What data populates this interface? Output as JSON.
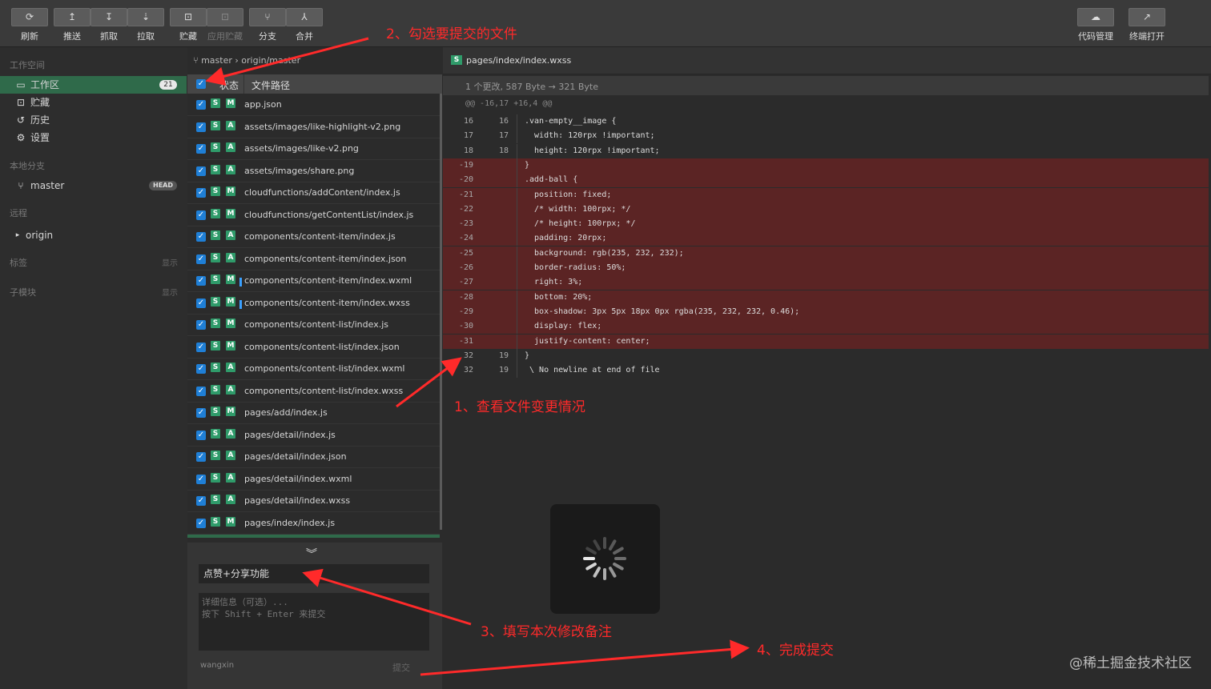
{
  "toolbar": {
    "left": [
      {
        "name": "refresh-button",
        "label": "刷新",
        "icon": "refresh-icon",
        "glyph": "⟳",
        "disabled": false
      },
      {
        "name": "push-button",
        "label": "推送",
        "icon": "push-icon",
        "glyph": "↥",
        "disabled": false
      },
      {
        "name": "fetch-button",
        "label": "抓取",
        "icon": "fetch-icon",
        "glyph": "↧",
        "disabled": false
      },
      {
        "name": "pull-button",
        "label": "拉取",
        "icon": "pull-icon",
        "glyph": "⇣",
        "disabled": false
      },
      {
        "name": "stash-button",
        "label": "贮藏",
        "icon": "stash-icon",
        "glyph": "⊡",
        "disabled": false
      },
      {
        "name": "apply-stash-button",
        "label": "应用贮藏",
        "icon": "apply-stash-icon",
        "glyph": "⊡",
        "disabled": true
      },
      {
        "name": "branch-button",
        "label": "分支",
        "icon": "branch-icon",
        "glyph": "⑂",
        "disabled": false
      },
      {
        "name": "merge-button",
        "label": "合并",
        "icon": "merge-icon",
        "glyph": "⅄",
        "disabled": false
      }
    ],
    "right": [
      {
        "name": "code-management-button",
        "label": "代码管理",
        "icon": "cloud-code-icon",
        "glyph": "☁"
      },
      {
        "name": "terminal-open-button",
        "label": "终端打开",
        "icon": "external-link-icon",
        "glyph": "↗"
      }
    ]
  },
  "sidebar": {
    "workspace_title": "工作空间",
    "items": [
      {
        "name": "sidebar-item-workspace",
        "label": "工作区",
        "icon": "folder-icon",
        "glyph": "▭",
        "badge": "21"
      },
      {
        "name": "sidebar-item-stash",
        "label": "贮藏",
        "icon": "stash-icon",
        "glyph": "⊡"
      },
      {
        "name": "sidebar-item-history",
        "label": "历史",
        "icon": "history-icon",
        "glyph": "↺"
      },
      {
        "name": "sidebar-item-settings",
        "label": "设置",
        "icon": "gear-icon",
        "glyph": "⚙"
      }
    ],
    "local_branches_title": "本地分支",
    "branch": {
      "label": "master",
      "badge": "HEAD",
      "glyph": "⑂"
    },
    "remote_title": "远程",
    "remote": {
      "label": "origin",
      "glyph": "▸"
    },
    "tags_title": "标签",
    "tags_action": "显示",
    "submodules_title": "子模块",
    "submodules_action": "显示"
  },
  "filelist": {
    "breadcrumb": "⑂ master › origin/master",
    "header_state": "状态",
    "header_path": "文件路径",
    "files": [
      {
        "s": "S",
        "m": "M",
        "path": "app.json",
        "marker": false
      },
      {
        "s": "S",
        "m": "A",
        "path": "assets/images/like-highlight-v2.png",
        "marker": false
      },
      {
        "s": "S",
        "m": "A",
        "path": "assets/images/like-v2.png",
        "marker": false
      },
      {
        "s": "S",
        "m": "A",
        "path": "assets/images/share.png",
        "marker": false
      },
      {
        "s": "S",
        "m": "M",
        "path": "cloudfunctions/addContent/index.js",
        "marker": false
      },
      {
        "s": "S",
        "m": "M",
        "path": "cloudfunctions/getContentList/index.js",
        "marker": false
      },
      {
        "s": "S",
        "m": "A",
        "path": "components/content-item/index.js",
        "marker": false
      },
      {
        "s": "S",
        "m": "A",
        "path": "components/content-item/index.json",
        "marker": false
      },
      {
        "s": "S",
        "m": "M",
        "path": "components/content-item/index.wxml",
        "marker": true
      },
      {
        "s": "S",
        "m": "M",
        "path": "components/content-item/index.wxss",
        "marker": true
      },
      {
        "s": "S",
        "m": "M",
        "path": "components/content-list/index.js",
        "marker": false
      },
      {
        "s": "S",
        "m": "M",
        "path": "components/content-list/index.json",
        "marker": false
      },
      {
        "s": "S",
        "m": "A",
        "path": "components/content-list/index.wxml",
        "marker": false
      },
      {
        "s": "S",
        "m": "A",
        "path": "components/content-list/index.wxss",
        "marker": false
      },
      {
        "s": "S",
        "m": "M",
        "path": "pages/add/index.js",
        "marker": false
      },
      {
        "s": "S",
        "m": "A",
        "path": "pages/detail/index.js",
        "marker": false
      },
      {
        "s": "S",
        "m": "A",
        "path": "pages/detail/index.json",
        "marker": false
      },
      {
        "s": "S",
        "m": "A",
        "path": "pages/detail/index.wxml",
        "marker": false
      },
      {
        "s": "S",
        "m": "A",
        "path": "pages/detail/index.wxss",
        "marker": false
      },
      {
        "s": "S",
        "m": "M",
        "path": "pages/index/index.js",
        "marker": false
      }
    ]
  },
  "commit": {
    "chevron": "︾",
    "summary": "点赞+分享功能",
    "description_placeholder_line1": "详细信息（可选）...",
    "description_placeholder_line2": "按下 Shift + Enter 来提交",
    "author": "wangxin",
    "submit_label": "提交"
  },
  "diff": {
    "file_badge": "S",
    "file": "pages/index/index.wxss",
    "summary": "1 个更改, 587 Byte → 321 Byte",
    "hunk": "@@ -16,17 +16,4 @@",
    "lines": [
      {
        "n1": "16",
        "n2": "16",
        "code": ".van-empty__image {",
        "del": false
      },
      {
        "n1": "17",
        "n2": "17",
        "code": "  width: 120rpx !important;",
        "del": false
      },
      {
        "n1": "18",
        "n2": "18",
        "code": "  height: 120rpx !important;",
        "del": false
      },
      {
        "n1": "-19",
        "n2": "",
        "code": "}",
        "del": true
      },
      {
        "n1": "-20",
        "n2": "",
        "code": ".add-ball {",
        "del": true
      },
      {
        "n1": "-21",
        "n2": "",
        "code": "  position: fixed;",
        "del": true
      },
      {
        "n1": "-22",
        "n2": "",
        "code": "  /* width: 100rpx; */",
        "del": true
      },
      {
        "n1": "-23",
        "n2": "",
        "code": "  /* height: 100rpx; */",
        "del": true
      },
      {
        "n1": "-24",
        "n2": "",
        "code": "  padding: 20rpx;",
        "del": true
      },
      {
        "n1": "-25",
        "n2": "",
        "code": "  background: rgb(235, 232, 232);",
        "del": true
      },
      {
        "n1": "-26",
        "n2": "",
        "code": "  border-radius: 50%;",
        "del": true
      },
      {
        "n1": "-27",
        "n2": "",
        "code": "  right: 3%;",
        "del": true
      },
      {
        "n1": "-28",
        "n2": "",
        "code": "  bottom: 20%;",
        "del": true
      },
      {
        "n1": "-29",
        "n2": "",
        "code": "  box-shadow: 3px 5px 18px 0px rgba(235, 232, 232, 0.46);",
        "del": true
      },
      {
        "n1": "-30",
        "n2": "",
        "code": "  display: flex;",
        "del": true
      },
      {
        "n1": "-31",
        "n2": "",
        "code": "  justify-content: center;",
        "del": true
      },
      {
        "n1": "32",
        "n2": "19",
        "code": "}",
        "del": false
      },
      {
        "n1": "32",
        "n2": "19",
        "code": " \\ No newline at end of file",
        "del": false
      }
    ]
  },
  "annotations": {
    "a1": "1、查看文件变更情况",
    "a2": "2、勾选要提交的文件",
    "a3": "3、填写本次修改备注",
    "a4": "4、完成提交"
  },
  "watermark": "@稀土掘金技术社区",
  "colors": {
    "accent_green": "#2f6a4a",
    "checkbox_blue": "#1f7fd6",
    "status_green": "#2f9b6a",
    "deleted_bg": "#5b2424",
    "annotation_red": "#ff2a2a"
  }
}
